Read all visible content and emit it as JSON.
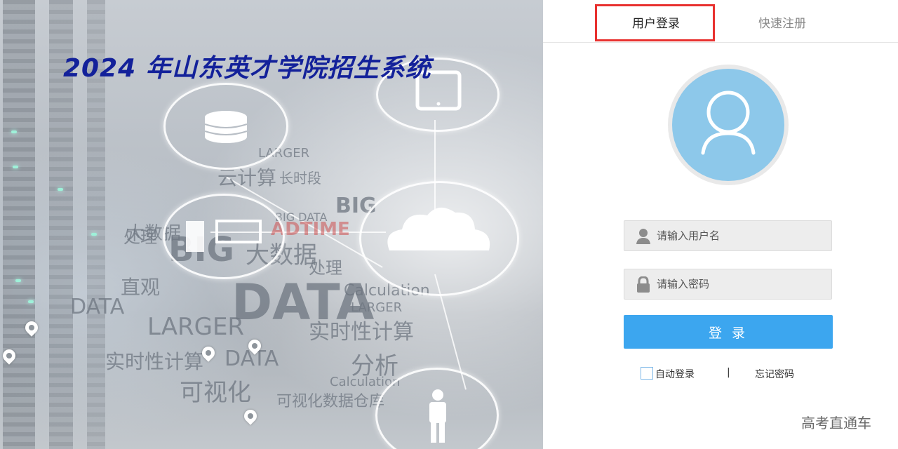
{
  "banner": {
    "title": "2024 年山东英才学院招生系统",
    "background_words": [
      "BIG DATA",
      "ADTIME",
      "DATA",
      "大数据",
      "处理",
      "直观",
      "实时性计算",
      "分析",
      "可视化",
      "可视化数据仓库",
      "Calculation",
      "LARGER",
      "BIG",
      "长时段",
      "云计算"
    ]
  },
  "tabs": {
    "login": "用户登录",
    "register": "快速注册"
  },
  "form": {
    "username_placeholder": "请输入用户名",
    "password_placeholder": "请输入密码",
    "submit_label": "登 录",
    "remember_label": "自动登录",
    "separator": "|",
    "forgot_label": "忘记密码"
  },
  "watermark": "高考直通车",
  "colors": {
    "title": "#13219a",
    "button": "#3ca6ef",
    "avatar": "#8dc8ea",
    "highlight": "#e8312f"
  },
  "icons": [
    "database-icon",
    "tablet-icon",
    "cloud-icon",
    "monitor-icon",
    "person-icon",
    "location-pin-icon",
    "user-icon",
    "lock-icon",
    "avatar-user-icon"
  ]
}
